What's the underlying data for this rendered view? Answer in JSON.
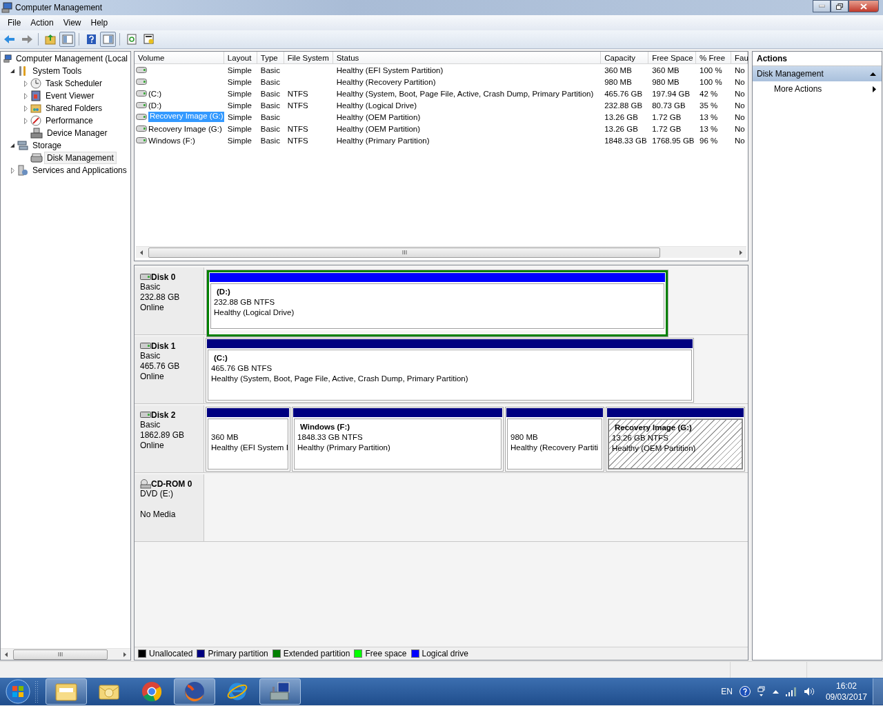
{
  "window": {
    "title": "Computer Management"
  },
  "menu": [
    "File",
    "Action",
    "View",
    "Help"
  ],
  "toolbar": [
    {
      "pressed": false
    },
    {
      "pressed": false
    },
    {
      "pressed": false
    },
    {
      "pressed": true
    },
    {
      "pressed": false
    },
    {
      "pressed": true
    },
    {
      "pressed": false
    },
    {
      "pressed": false
    }
  ],
  "tree": [
    {
      "label": "Computer Management (Local",
      "selected": false,
      "children": [
        {
          "label": "System Tools",
          "expanded": true,
          "selected": false,
          "children": [
            {
              "label": "Task Scheduler",
              "expanded": false,
              "selected": false
            },
            {
              "label": "Event Viewer",
              "expanded": false,
              "selected": false
            },
            {
              "label": "Shared Folders",
              "expanded": false,
              "selected": false
            },
            {
              "label": "Performance",
              "expanded": false,
              "selected": false
            },
            {
              "label": "Device Manager",
              "selected": false
            }
          ]
        },
        {
          "label": "Storage",
          "expanded": true,
          "selected": false,
          "children": [
            {
              "label": "Disk Management",
              "selected": true
            }
          ]
        },
        {
          "label": "Services and Applications",
          "expanded": false,
          "selected": false
        }
      ]
    }
  ],
  "table": {
    "columns": [
      "Volume",
      "Layout",
      "Type",
      "File System",
      "Status",
      "Capacity",
      "Free Space",
      "% Free",
      "Fau"
    ],
    "rows": [
      {
        "layout": "Simple",
        "type": "Basic",
        "status": "Healthy (EFI System Partition)",
        "capacity": "360 MB",
        "free_space": "360 MB",
        "percent_free": "100 %",
        "fau": "No",
        "selected": false
      },
      {
        "layout": "Simple",
        "type": "Basic",
        "status": "Healthy (Recovery Partition)",
        "capacity": "980 MB",
        "free_space": "980 MB",
        "percent_free": "100 %",
        "fau": "No",
        "selected": false
      },
      {
        "volume": "(C:)",
        "layout": "Simple",
        "type": "Basic",
        "file_system": "NTFS",
        "status": "Healthy (System, Boot, Page File, Active, Crash Dump, Primary Partition)",
        "capacity": "465.76 GB",
        "free_space": "197.94 GB",
        "percent_free": "42 %",
        "fau": "No",
        "selected": false
      },
      {
        "volume": "(D:)",
        "layout": "Simple",
        "type": "Basic",
        "file_system": "NTFS",
        "status": "Healthy (Logical Drive)",
        "capacity": "232.88 GB",
        "free_space": "80.73 GB",
        "percent_free": "35 %",
        "fau": "No",
        "selected": false
      },
      {
        "volume": "Recovery Image (G:)",
        "layout": "Simple",
        "type": "Basic",
        "status": "Healthy (OEM Partition)",
        "capacity": "13.26 GB",
        "free_space": "1.72 GB",
        "percent_free": "13 %",
        "fau": "No",
        "selected": true
      },
      {
        "volume": "Recovery Image (G:)",
        "layout": "Simple",
        "type": "Basic",
        "file_system": "NTFS",
        "status": "Healthy (OEM Partition)",
        "capacity": "13.26 GB",
        "free_space": "1.72 GB",
        "percent_free": "13 %",
        "fau": "No",
        "selected": false
      },
      {
        "volume": "Windows (F:)",
        "layout": "Simple",
        "type": "Basic",
        "file_system": "NTFS",
        "status": "Healthy (Primary Partition)",
        "capacity": "1848.33 GB",
        "free_space": "1768.95 GB",
        "percent_free": "96 %",
        "fau": "No",
        "selected": false
      }
    ]
  },
  "disks": [
    {
      "kind": "disk",
      "name": "Disk 0",
      "type": "Basic",
      "size": "232.88 GB",
      "status": "Online",
      "partitions": [
        {
          "kind": "logical",
          "label": "(D:)",
          "detail": "232.88 GB NTFS",
          "status": "Healthy (Logical Drive)",
          "selected": false
        }
      ]
    },
    {
      "kind": "disk",
      "name": "Disk 1",
      "type": "Basic",
      "size": "465.76 GB",
      "status": "Online",
      "partitions": [
        {
          "kind": "primary",
          "label": "(C:)",
          "detail": "465.76 GB NTFS",
          "status": "Healthy (System, Boot, Page File, Active, Crash Dump, Primary Partition)",
          "selected": false
        }
      ]
    },
    {
      "kind": "disk",
      "name": "Disk 2",
      "type": "Basic",
      "size": "1862.89 GB",
      "status": "Online",
      "partitions": [
        {
          "kind": "primary",
          "detail": "360 MB",
          "status": "Healthy (EFI System I",
          "selected": false
        },
        {
          "kind": "primary",
          "label": "Windows  (F:)",
          "detail": "1848.33 GB NTFS",
          "status": "Healthy (Primary Partition)",
          "selected": false
        },
        {
          "kind": "primary",
          "detail": "980 MB",
          "status": "Healthy (Recovery Partiti",
          "selected": false
        },
        {
          "kind": "primary",
          "label": "Recovery Image  (G:)",
          "detail": "13.26 GB NTFS",
          "status": "Healthy (OEM Partition)",
          "selected": true
        }
      ]
    },
    {
      "kind": "cdrom",
      "name": "CD-ROM 0",
      "drive": "DVD (E:)",
      "status": "No Media"
    }
  ],
  "legend": [
    {
      "label": "Unallocated",
      "color": "#000000"
    },
    {
      "label": "Primary partition",
      "color": "#000080"
    },
    {
      "label": "Extended partition",
      "color": "#008000"
    },
    {
      "label": "Free space",
      "color": "#00ff00"
    },
    {
      "label": "Logical drive",
      "color": "#0000ff"
    }
  ],
  "actions": {
    "title": "Actions",
    "section": {
      "label": "Disk Management",
      "expanded": true
    },
    "items": [
      {
        "label": "More Actions"
      }
    ]
  },
  "taskbar": {
    "apps": [
      {
        "running": true
      },
      {
        "running": false
      },
      {
        "running": false
      },
      {
        "running": true
      },
      {
        "running": false
      },
      {
        "running": true
      }
    ],
    "language": "EN",
    "time": "16:02",
    "date": "09/03/2017"
  }
}
